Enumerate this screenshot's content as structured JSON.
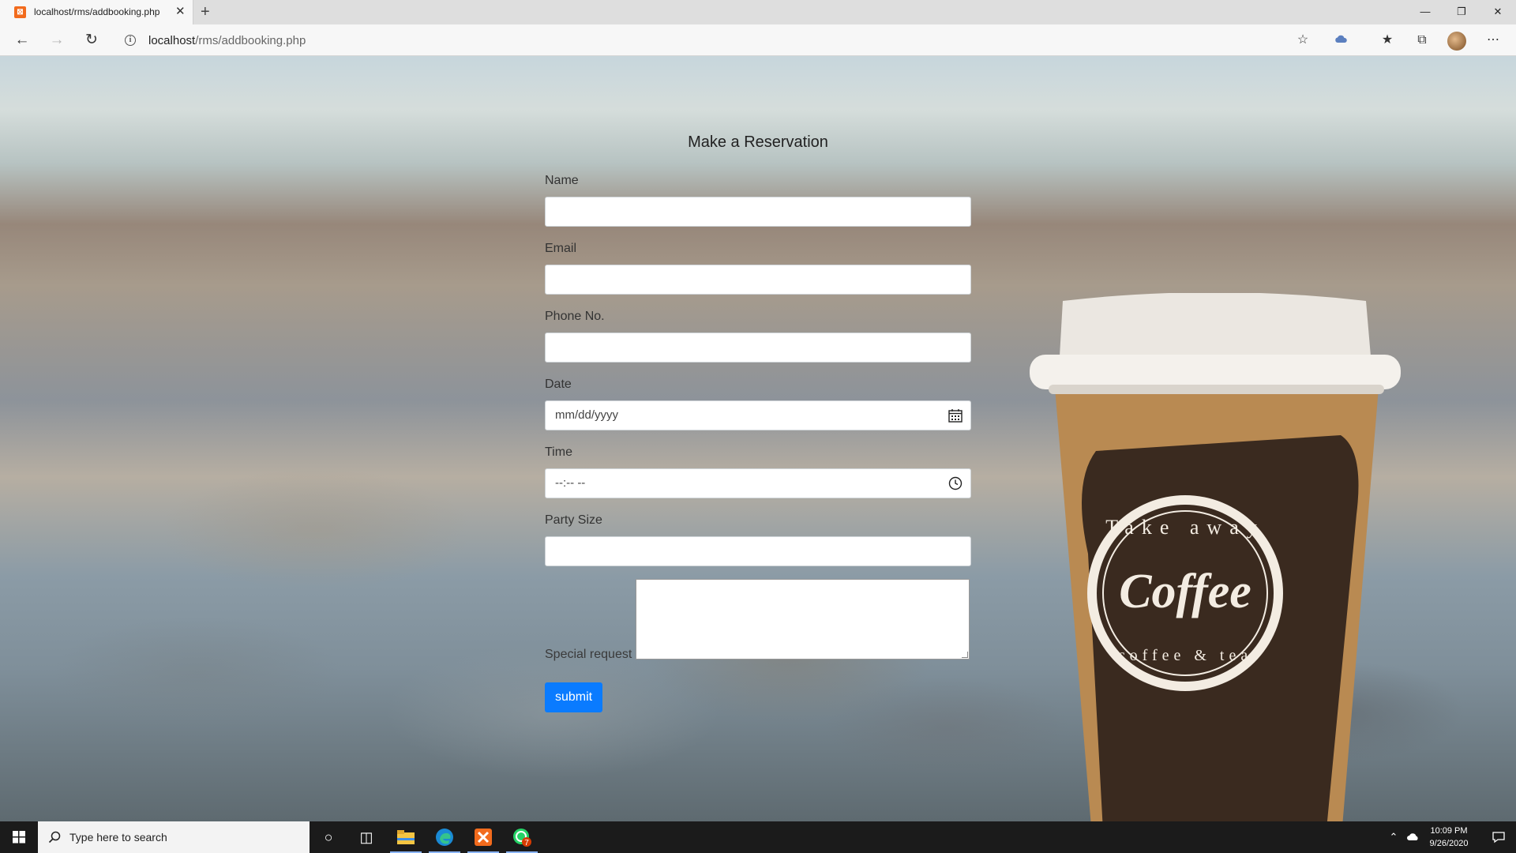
{
  "browser": {
    "tab_title": "localhost/rms/addbooking.php",
    "url_host": "localhost",
    "url_path": "/rms/addbooking.php",
    "new_tab": "+",
    "tab_close": "✕"
  },
  "form": {
    "title": "Make a Reservation",
    "fields": {
      "name_label": "Name",
      "email_label": "Email",
      "phone_label": "Phone No.",
      "date_label": "Date",
      "date_placeholder": "mm/dd/yyyy",
      "time_label": "Time",
      "time_placeholder": "--:-- --",
      "party_label": "Party Size",
      "special_label": "Special request"
    },
    "submit_label": "submit"
  },
  "cup": {
    "brand": "Coffee",
    "top_text": "Take away",
    "bottom_text": "coffee & tea"
  },
  "taskbar": {
    "search_placeholder": "Type here to search",
    "time": "10:09 PM",
    "date": "9/26/2020",
    "badge_count": "7"
  },
  "colors": {
    "submit_bg": "#0a7bff",
    "taskbar_bg": "#1b1b1b"
  }
}
